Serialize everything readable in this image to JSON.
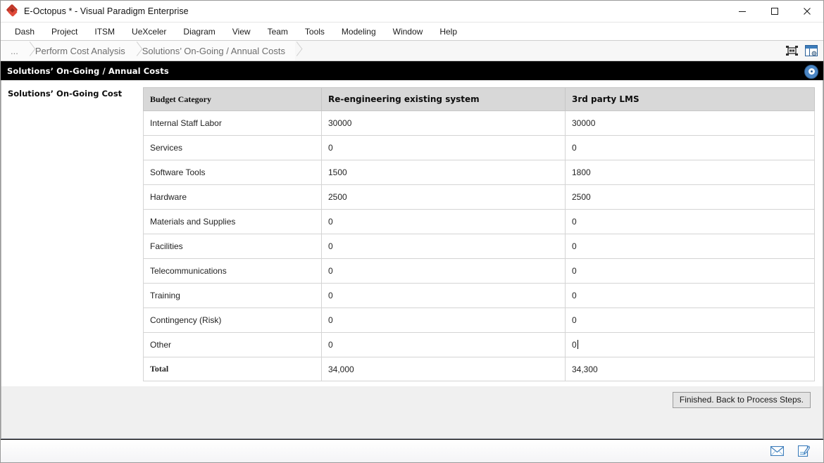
{
  "window": {
    "title": "E-Octopus * - Visual Paradigm Enterprise",
    "logo_icon": "visual-paradigm-diamond-logo",
    "controls": {
      "minimize": "minimize-icon",
      "maximize": "maximize-icon",
      "close": "close-icon"
    }
  },
  "menubar": {
    "items": [
      {
        "label": "Dash"
      },
      {
        "label": "Project"
      },
      {
        "label": "ITSM"
      },
      {
        "label": "UeXceler"
      },
      {
        "label": "Diagram"
      },
      {
        "label": "View"
      },
      {
        "label": "Team"
      },
      {
        "label": "Tools"
      },
      {
        "label": "Modeling"
      },
      {
        "label": "Window"
      },
      {
        "label": "Help"
      }
    ]
  },
  "breadcrumb": {
    "items": [
      {
        "label": "..."
      },
      {
        "label": "Perform Cost Analysis"
      },
      {
        "label": "Solutions’ On-Going / Annual Costs"
      }
    ],
    "toolbar": [
      {
        "icon": "fit-to-screen-icon"
      },
      {
        "icon": "panel-layout-icon"
      }
    ]
  },
  "page_header": {
    "title": "Solutions’ On-Going / Annual Costs",
    "badge_icon": "info-locator-icon"
  },
  "left_pane": {
    "section_title": "Solutions’ On-Going Cost"
  },
  "table": {
    "columns": [
      "Budget Category",
      "Re-engineering existing system",
      "3rd party LMS"
    ],
    "rows": [
      {
        "category": "Internal Staff Labor",
        "reengineering": "30000",
        "third_party": "30000"
      },
      {
        "category": "Services",
        "reengineering": "0",
        "third_party": "0"
      },
      {
        "category": "Software Tools",
        "reengineering": "1500",
        "third_party": "1800"
      },
      {
        "category": "Hardware",
        "reengineering": "2500",
        "third_party": "2500"
      },
      {
        "category": "Materials and Supplies",
        "reengineering": "0",
        "third_party": "0"
      },
      {
        "category": "Facilities",
        "reengineering": "0",
        "third_party": "0"
      },
      {
        "category": "Telecommunications",
        "reengineering": "0",
        "third_party": "0"
      },
      {
        "category": "Training",
        "reengineering": "0",
        "third_party": "0"
      },
      {
        "category": "Contingency (Risk)",
        "reengineering": "0",
        "third_party": "0"
      },
      {
        "category": "Other",
        "reengineering": "0",
        "third_party": "0"
      }
    ],
    "total": {
      "label": "Total",
      "reengineering": "34,000",
      "third_party": "34,300"
    },
    "editing_cell": {
      "row": "Other",
      "column": "3rd party LMS",
      "value": "0",
      "caret": true
    }
  },
  "footer": {
    "finish_button": "Finished. Back to Process Steps."
  },
  "statusbar": {
    "icons": [
      {
        "name": "mail-envelope-icon"
      },
      {
        "name": "note-edit-icon"
      }
    ]
  },
  "colors": {
    "accent_blue": "#4b86c4",
    "header_black": "#000000",
    "table_header_gray": "#d8d8d8",
    "logo_red": "#c0392b"
  }
}
